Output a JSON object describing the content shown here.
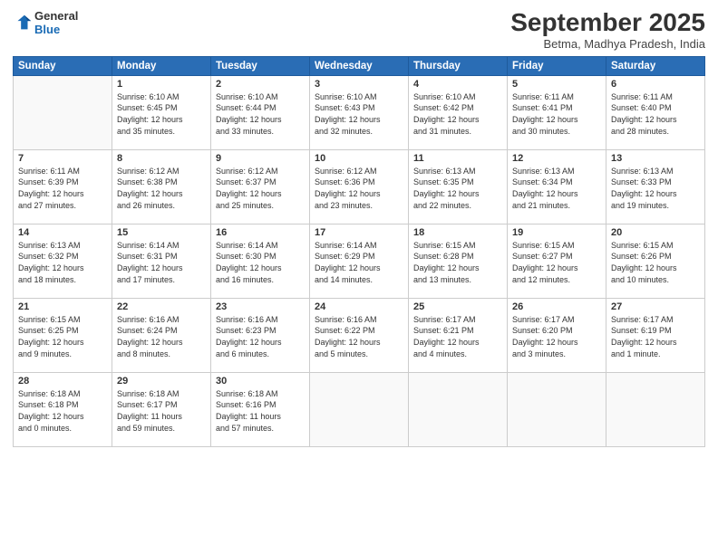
{
  "logo": {
    "line1": "General",
    "line2": "Blue"
  },
  "title": "September 2025",
  "subtitle": "Betma, Madhya Pradesh, India",
  "headers": [
    "Sunday",
    "Monday",
    "Tuesday",
    "Wednesday",
    "Thursday",
    "Friday",
    "Saturday"
  ],
  "weeks": [
    [
      {
        "day": "",
        "info": ""
      },
      {
        "day": "1",
        "info": "Sunrise: 6:10 AM\nSunset: 6:45 PM\nDaylight: 12 hours\nand 35 minutes."
      },
      {
        "day": "2",
        "info": "Sunrise: 6:10 AM\nSunset: 6:44 PM\nDaylight: 12 hours\nand 33 minutes."
      },
      {
        "day": "3",
        "info": "Sunrise: 6:10 AM\nSunset: 6:43 PM\nDaylight: 12 hours\nand 32 minutes."
      },
      {
        "day": "4",
        "info": "Sunrise: 6:10 AM\nSunset: 6:42 PM\nDaylight: 12 hours\nand 31 minutes."
      },
      {
        "day": "5",
        "info": "Sunrise: 6:11 AM\nSunset: 6:41 PM\nDaylight: 12 hours\nand 30 minutes."
      },
      {
        "day": "6",
        "info": "Sunrise: 6:11 AM\nSunset: 6:40 PM\nDaylight: 12 hours\nand 28 minutes."
      }
    ],
    [
      {
        "day": "7",
        "info": "Sunrise: 6:11 AM\nSunset: 6:39 PM\nDaylight: 12 hours\nand 27 minutes."
      },
      {
        "day": "8",
        "info": "Sunrise: 6:12 AM\nSunset: 6:38 PM\nDaylight: 12 hours\nand 26 minutes."
      },
      {
        "day": "9",
        "info": "Sunrise: 6:12 AM\nSunset: 6:37 PM\nDaylight: 12 hours\nand 25 minutes."
      },
      {
        "day": "10",
        "info": "Sunrise: 6:12 AM\nSunset: 6:36 PM\nDaylight: 12 hours\nand 23 minutes."
      },
      {
        "day": "11",
        "info": "Sunrise: 6:13 AM\nSunset: 6:35 PM\nDaylight: 12 hours\nand 22 minutes."
      },
      {
        "day": "12",
        "info": "Sunrise: 6:13 AM\nSunset: 6:34 PM\nDaylight: 12 hours\nand 21 minutes."
      },
      {
        "day": "13",
        "info": "Sunrise: 6:13 AM\nSunset: 6:33 PM\nDaylight: 12 hours\nand 19 minutes."
      }
    ],
    [
      {
        "day": "14",
        "info": "Sunrise: 6:13 AM\nSunset: 6:32 PM\nDaylight: 12 hours\nand 18 minutes."
      },
      {
        "day": "15",
        "info": "Sunrise: 6:14 AM\nSunset: 6:31 PM\nDaylight: 12 hours\nand 17 minutes."
      },
      {
        "day": "16",
        "info": "Sunrise: 6:14 AM\nSunset: 6:30 PM\nDaylight: 12 hours\nand 16 minutes."
      },
      {
        "day": "17",
        "info": "Sunrise: 6:14 AM\nSunset: 6:29 PM\nDaylight: 12 hours\nand 14 minutes."
      },
      {
        "day": "18",
        "info": "Sunrise: 6:15 AM\nSunset: 6:28 PM\nDaylight: 12 hours\nand 13 minutes."
      },
      {
        "day": "19",
        "info": "Sunrise: 6:15 AM\nSunset: 6:27 PM\nDaylight: 12 hours\nand 12 minutes."
      },
      {
        "day": "20",
        "info": "Sunrise: 6:15 AM\nSunset: 6:26 PM\nDaylight: 12 hours\nand 10 minutes."
      }
    ],
    [
      {
        "day": "21",
        "info": "Sunrise: 6:15 AM\nSunset: 6:25 PM\nDaylight: 12 hours\nand 9 minutes."
      },
      {
        "day": "22",
        "info": "Sunrise: 6:16 AM\nSunset: 6:24 PM\nDaylight: 12 hours\nand 8 minutes."
      },
      {
        "day": "23",
        "info": "Sunrise: 6:16 AM\nSunset: 6:23 PM\nDaylight: 12 hours\nand 6 minutes."
      },
      {
        "day": "24",
        "info": "Sunrise: 6:16 AM\nSunset: 6:22 PM\nDaylight: 12 hours\nand 5 minutes."
      },
      {
        "day": "25",
        "info": "Sunrise: 6:17 AM\nSunset: 6:21 PM\nDaylight: 12 hours\nand 4 minutes."
      },
      {
        "day": "26",
        "info": "Sunrise: 6:17 AM\nSunset: 6:20 PM\nDaylight: 12 hours\nand 3 minutes."
      },
      {
        "day": "27",
        "info": "Sunrise: 6:17 AM\nSunset: 6:19 PM\nDaylight: 12 hours\nand 1 minute."
      }
    ],
    [
      {
        "day": "28",
        "info": "Sunrise: 6:18 AM\nSunset: 6:18 PM\nDaylight: 12 hours\nand 0 minutes."
      },
      {
        "day": "29",
        "info": "Sunrise: 6:18 AM\nSunset: 6:17 PM\nDaylight: 11 hours\nand 59 minutes."
      },
      {
        "day": "30",
        "info": "Sunrise: 6:18 AM\nSunset: 6:16 PM\nDaylight: 11 hours\nand 57 minutes."
      },
      {
        "day": "",
        "info": ""
      },
      {
        "day": "",
        "info": ""
      },
      {
        "day": "",
        "info": ""
      },
      {
        "day": "",
        "info": ""
      }
    ]
  ]
}
